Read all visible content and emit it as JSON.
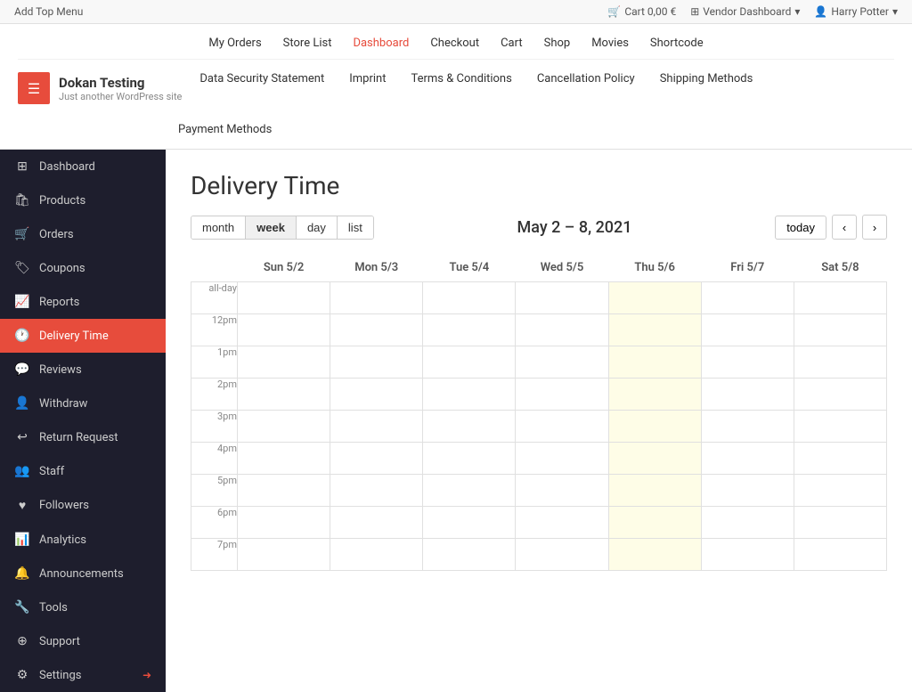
{
  "adminBar": {
    "addMenu": "Add Top Menu",
    "cart": "Cart 0,00 €",
    "vendorDashboard": "Vendor Dashboard",
    "user": "Harry Potter"
  },
  "topNav": {
    "items": [
      {
        "label": "My Orders",
        "active": false
      },
      {
        "label": "Store List",
        "active": false
      },
      {
        "label": "Dashboard",
        "active": true
      },
      {
        "label": "Checkout",
        "active": false
      },
      {
        "label": "Cart",
        "active": false
      },
      {
        "label": "Shop",
        "active": false
      },
      {
        "label": "Movies",
        "active": false
      },
      {
        "label": "Shortcode",
        "active": false
      }
    ]
  },
  "site": {
    "name": "Dokan Testing",
    "tagline": "Just another WordPress site"
  },
  "secondNav": {
    "items": [
      {
        "label": "Data Security Statement"
      },
      {
        "label": "Imprint"
      },
      {
        "label": "Terms & Conditions"
      },
      {
        "label": "Cancellation Policy"
      },
      {
        "label": "Shipping Methods"
      }
    ]
  },
  "thirdNav": {
    "items": [
      {
        "label": "Payment Methods"
      }
    ]
  },
  "sidebar": {
    "items": [
      {
        "label": "Dashboard",
        "icon": "⊞",
        "active": false
      },
      {
        "label": "Products",
        "icon": "🛍",
        "active": false
      },
      {
        "label": "Orders",
        "icon": "🛒",
        "active": false
      },
      {
        "label": "Coupons",
        "icon": "🏷",
        "active": false
      },
      {
        "label": "Reports",
        "icon": "📈",
        "active": false
      },
      {
        "label": "Delivery Time",
        "icon": "🕐",
        "active": true
      },
      {
        "label": "Reviews",
        "icon": "💬",
        "active": false
      },
      {
        "label": "Withdraw",
        "icon": "👤",
        "active": false
      },
      {
        "label": "Return Request",
        "icon": "↩",
        "active": false
      },
      {
        "label": "Staff",
        "icon": "👥",
        "active": false
      },
      {
        "label": "Followers",
        "icon": "❤",
        "active": false
      },
      {
        "label": "Analytics",
        "icon": "📊",
        "active": false
      },
      {
        "label": "Announcements",
        "icon": "🔔",
        "active": false
      },
      {
        "label": "Tools",
        "icon": "🔧",
        "active": false
      },
      {
        "label": "Support",
        "icon": "⊕",
        "active": false
      },
      {
        "label": "Settings",
        "icon": "⚙",
        "active": false
      }
    ]
  },
  "calendar": {
    "pageTitle": "Delivery Time",
    "dateRange": "May 2 – 8, 2021",
    "viewButtons": [
      "month",
      "week",
      "day",
      "list"
    ],
    "activeView": "week",
    "todayLabel": "today",
    "columns": [
      "Sun 5/2",
      "Mon 5/3",
      "Tue 5/4",
      "Wed 5/5",
      "Thu 5/6",
      "Fri 5/7",
      "Sat 5/8"
    ],
    "timeSlots": [
      "all-day",
      "12pm",
      "1pm",
      "2pm",
      "3pm",
      "4pm",
      "5pm",
      "6pm",
      "7pm"
    ],
    "highlightedCol": 4
  }
}
